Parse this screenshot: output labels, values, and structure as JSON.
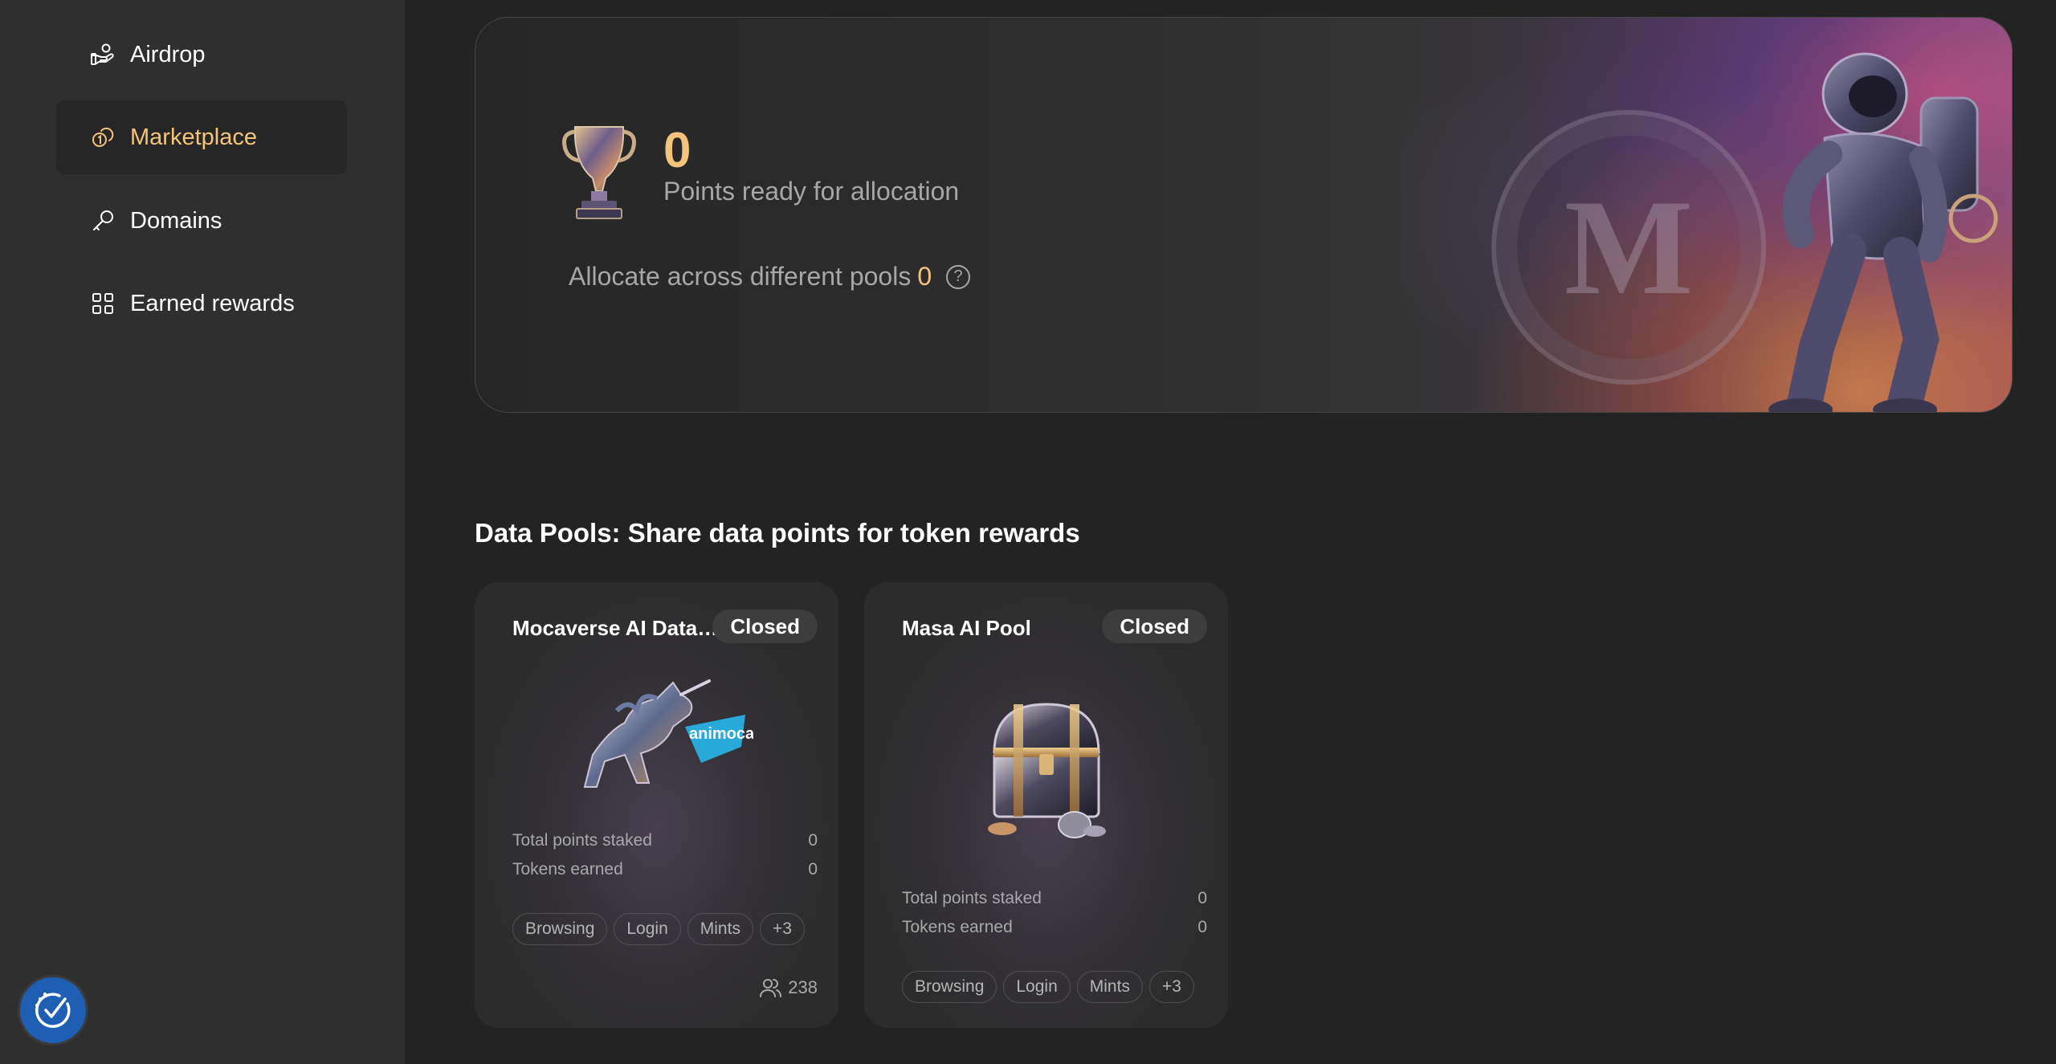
{
  "sidebar": {
    "items": [
      {
        "label": "Airdrop",
        "icon": "hand-coin-icon",
        "active": false
      },
      {
        "label": "Marketplace",
        "icon": "coins-icon",
        "active": true
      },
      {
        "label": "Domains",
        "icon": "key-icon",
        "active": false
      },
      {
        "label": "Earned rewards",
        "icon": "grid-icon",
        "active": false
      }
    ]
  },
  "hero": {
    "points_value": "0",
    "points_label": "Points ready for allocation",
    "allocate_label": "Allocate across different pools",
    "allocate_value": "0",
    "help_symbol": "?"
  },
  "pools": {
    "title": "Data Pools: Share data points for token rewards",
    "cards": [
      {
        "title": "Mocaverse AI Data Pool",
        "status": "Closed",
        "image": "unicorn-animoca-brands-image",
        "image_text": "animoca BRANDS",
        "total_points_label": "Total points staked",
        "total_points_value": "0",
        "tokens_label": "Tokens earned",
        "tokens_value": "0",
        "tags": [
          "Browsing",
          "Login",
          "Mints",
          "+3"
        ],
        "participants": "238"
      },
      {
        "title": "Masa AI Pool",
        "status": "Closed",
        "image": "treasure-chest-image",
        "total_points_label": "Total points staked",
        "total_points_value": "0",
        "tokens_label": "Tokens earned",
        "tokens_value": "0",
        "tags": [
          "Browsing",
          "Login",
          "Mints",
          "+3"
        ]
      }
    ]
  },
  "colors": {
    "accent": "#f4c47a",
    "sidebar_bg": "#2f2f2f",
    "page_bg": "#232323",
    "verify_button": "#1f5fb3"
  }
}
